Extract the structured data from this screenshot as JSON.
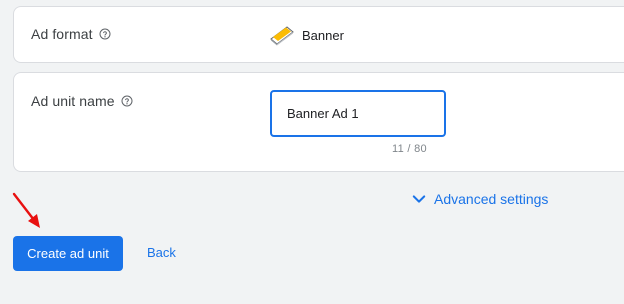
{
  "ad_format": {
    "label": "Ad format",
    "help_icon": "help-circle-icon",
    "value": "Banner",
    "value_icon": "banner-format-icon"
  },
  "ad_unit_name": {
    "label": "Ad unit name",
    "help_icon": "help-circle-icon",
    "value": "Banner Ad 1",
    "counter": "11 / 80"
  },
  "advanced_settings": {
    "label": "Advanced settings",
    "icon": "chevron-down-icon"
  },
  "actions": {
    "create_label": "Create ad unit",
    "back_label": "Back"
  },
  "colors": {
    "accent": "#1a73e8",
    "background": "#f1f3f4",
    "annotation_arrow": "#e81010"
  }
}
